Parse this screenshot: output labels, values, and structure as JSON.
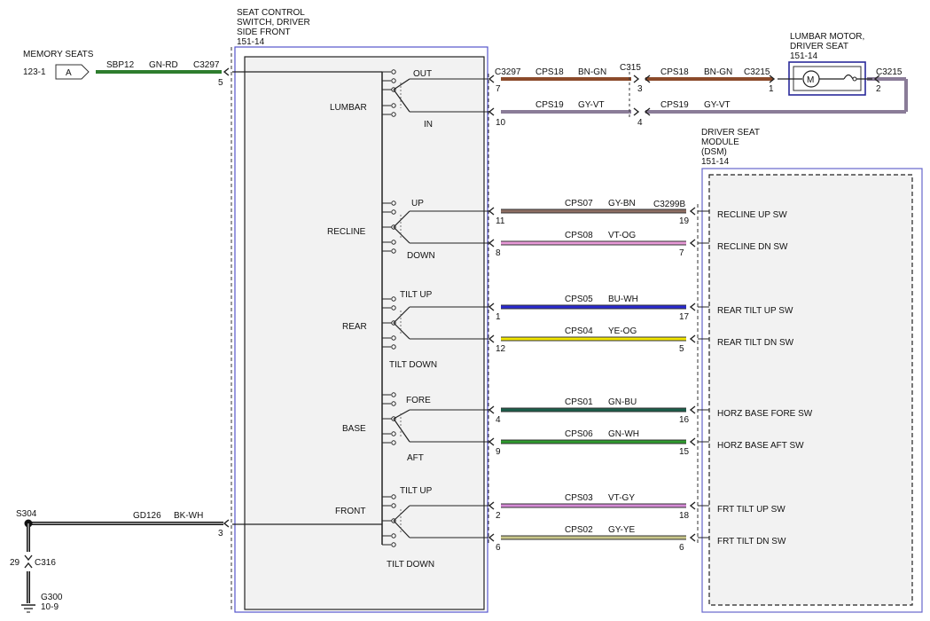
{
  "memory_seats": {
    "title": "MEMORY SEATS",
    "ref": "123-1",
    "connector_letter": "A",
    "circuit": "SBP12",
    "color_code": "GN-RD",
    "connector": "C3297",
    "pin": "5"
  },
  "switch": {
    "title_line1": "SEAT CONTROL",
    "title_line2": "SWITCH, DRIVER",
    "title_line3": "SIDE FRONT",
    "ref": "151-14"
  },
  "groups": {
    "lumbar": {
      "label": "LUMBAR",
      "pos_a": "OUT",
      "pos_b": "IN"
    },
    "recline": {
      "label": "RECLINE",
      "pos_a": "UP",
      "pos_b": "DOWN"
    },
    "rear": {
      "label": "REAR",
      "pos_a": "TILT UP",
      "pos_b": "TILT DOWN"
    },
    "base": {
      "label": "BASE",
      "pos_a": "FORE",
      "pos_b": "AFT"
    },
    "front": {
      "label": "FRONT",
      "pos_a": "TILT UP",
      "pos_b": "TILT DOWN"
    }
  },
  "lumbar_motor": {
    "title_line1": "LUMBAR MOTOR,",
    "title_line2": "DRIVER SEAT",
    "ref": "151-14",
    "symbol": "M",
    "connector": "C3215",
    "pin_in": "1",
    "pin_out": "2"
  },
  "lumbar_wiring": {
    "out": {
      "connector": "C3297",
      "pin": "7",
      "circuit": "CPS18",
      "color_code": "BN-GN",
      "inline_connector": "C315",
      "inline_pin": "3",
      "circuit_b": "CPS18",
      "color_code_b": "BN-GN",
      "end_connector": "C3215",
      "color": "#8b4a2a"
    },
    "in": {
      "pin": "10",
      "circuit": "CPS19",
      "color_code": "GY-VT",
      "inline_pin": "4",
      "circuit_b": "CPS19",
      "color_code_b": "GY-VT",
      "color": "#8a7c98"
    }
  },
  "dsm": {
    "title_line1": "DRIVER SEAT",
    "title_line2": "MODULE",
    "title_line3": "(DSM)",
    "ref": "151-14",
    "connector": "C3299B"
  },
  "circuits": [
    {
      "circuit": "CPS07",
      "color_code": "GY-BN",
      "left_pin": "11",
      "right_pin": "19",
      "signal": "RECLINE UP SW",
      "color": "#8d6e63"
    },
    {
      "circuit": "CPS08",
      "color_code": "VT-OG",
      "left_pin": "8",
      "right_pin": "7",
      "signal": "RECLINE DN SW",
      "color": "#e89ad8"
    },
    {
      "circuit": "CPS05",
      "color_code": "BU-WH",
      "left_pin": "1",
      "right_pin": "17",
      "signal": "REAR TILT UP SW",
      "color": "#2a2ad0"
    },
    {
      "circuit": "CPS04",
      "color_code": "YE-OG",
      "left_pin": "12",
      "right_pin": "5",
      "signal": "REAR TILT DN SW",
      "color": "#f2e600"
    },
    {
      "circuit": "CPS01",
      "color_code": "GN-BU",
      "left_pin": "4",
      "right_pin": "16",
      "signal": "HORZ BASE FORE SW",
      "color": "#1b5e4a"
    },
    {
      "circuit": "CPS06",
      "color_code": "GN-WH",
      "left_pin": "9",
      "right_pin": "15",
      "signal": "HORZ BASE AFT SW",
      "color": "#2e9a2e"
    },
    {
      "circuit": "CPS03",
      "color_code": "VT-GY",
      "left_pin": "2",
      "right_pin": "18",
      "signal": "FRT TILT UP SW",
      "color": "#d58ad6"
    },
    {
      "circuit": "CPS02",
      "color_code": "GY-YE",
      "left_pin": "6",
      "right_pin": "6",
      "signal": "FRT TILT DN SW",
      "color": "#c8c68a"
    }
  ],
  "ground": {
    "splice": "S304",
    "circuit": "GD126",
    "color_code": "BK-WH",
    "pin": "3",
    "connector_pin": "29",
    "connector": "C316",
    "ground_point": "G300",
    "ref": "10-9"
  }
}
